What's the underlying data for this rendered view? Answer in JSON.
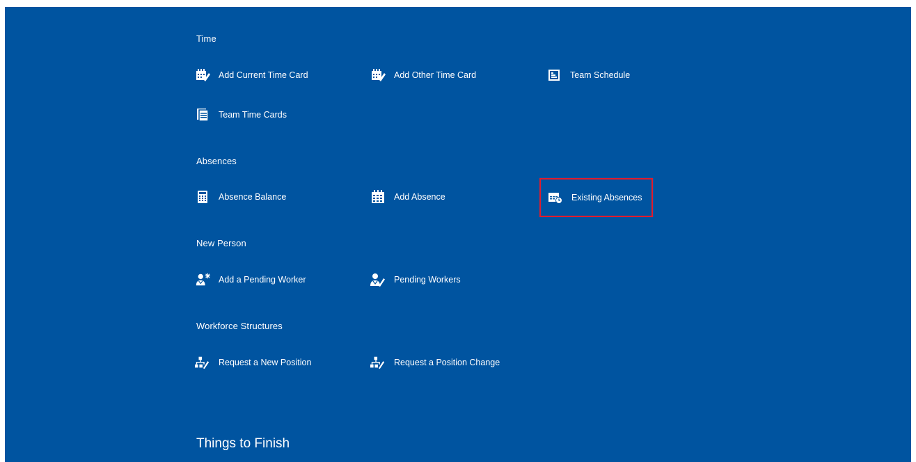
{
  "sections": {
    "time": {
      "title": "Time",
      "items": [
        {
          "label": "Add Current Time Card",
          "icon": "time-card-icon"
        },
        {
          "label": "Add Other Time Card",
          "icon": "time-card-icon"
        },
        {
          "label": "Team Schedule",
          "icon": "schedule-icon"
        },
        {
          "label": "Team Time Cards",
          "icon": "documents-icon"
        }
      ]
    },
    "absences": {
      "title": "Absences",
      "items": [
        {
          "label": "Absence Balance",
          "icon": "calculator-icon"
        },
        {
          "label": "Add Absence",
          "icon": "calendar-icon"
        },
        {
          "label": "Existing Absences",
          "icon": "calendar-clock-icon"
        }
      ]
    },
    "new_person": {
      "title": "New Person",
      "items": [
        {
          "label": "Add a Pending Worker",
          "icon": "add-person-icon"
        },
        {
          "label": "Pending Workers",
          "icon": "person-edit-icon"
        }
      ]
    },
    "workforce": {
      "title": "Workforce Structures",
      "items": [
        {
          "label": "Request a New Position",
          "icon": "org-chart-icon"
        },
        {
          "label": "Request a Position Change",
          "icon": "org-chart-icon"
        }
      ]
    }
  },
  "things_to_finish": {
    "title": "Things to Finish"
  },
  "colors": {
    "background": "#0054a0",
    "highlight": "#e21b2b",
    "text": "#ffffff"
  }
}
